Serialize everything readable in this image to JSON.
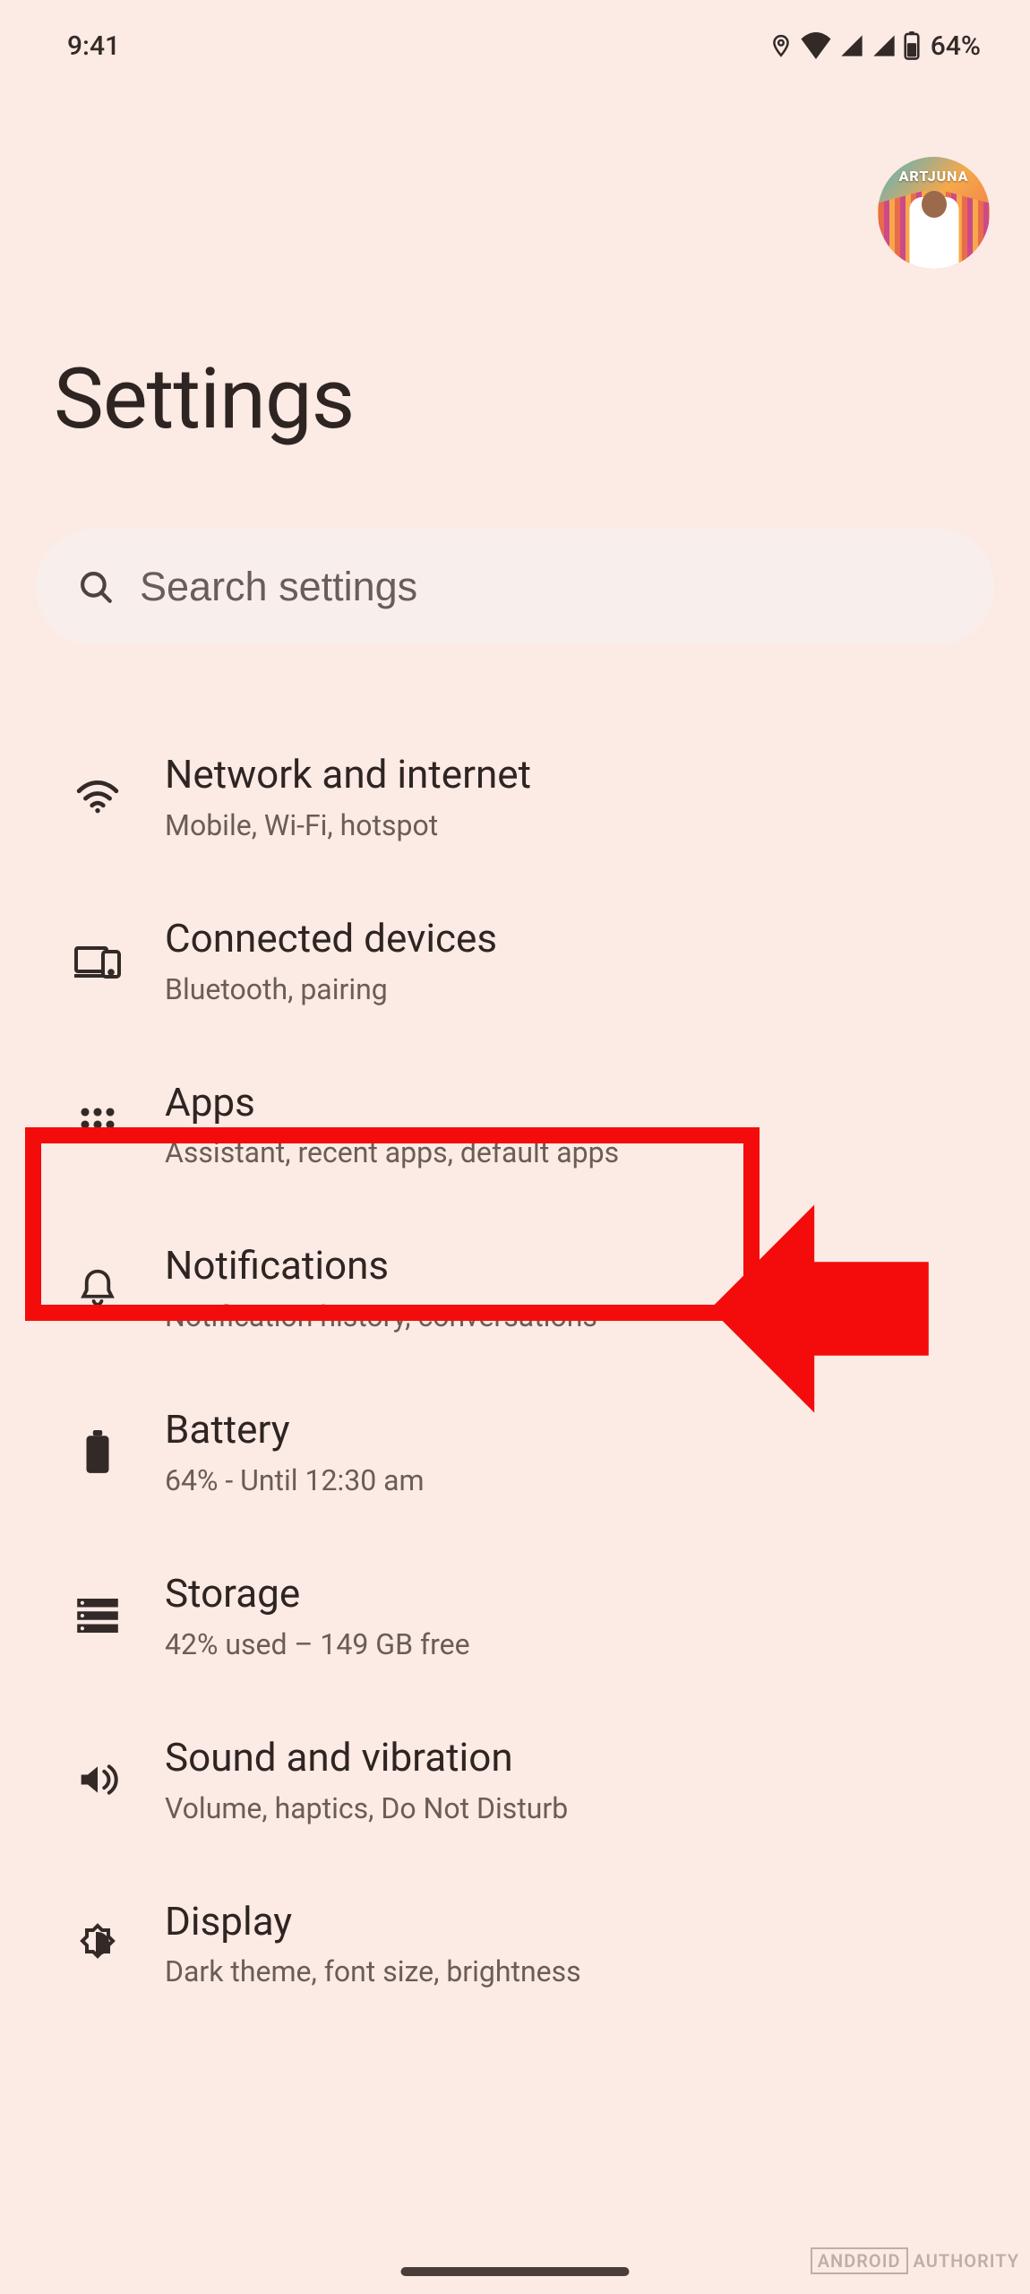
{
  "status": {
    "time": "9:41",
    "battery_text": "64%"
  },
  "header": {
    "title": "Settings",
    "avatar_label": "ARTJUNA"
  },
  "search": {
    "placeholder": "Search settings"
  },
  "items": [
    {
      "id": "network",
      "title": "Network and internet",
      "sub": "Mobile, Wi-Fi, hotspot"
    },
    {
      "id": "devices",
      "title": "Connected devices",
      "sub": "Bluetooth, pairing"
    },
    {
      "id": "apps",
      "title": "Apps",
      "sub": "Assistant, recent apps, default apps"
    },
    {
      "id": "notifications",
      "title": "Notifications",
      "sub": "Notification history, conversations"
    },
    {
      "id": "battery",
      "title": "Battery",
      "sub": "64% - Until 12:30 am"
    },
    {
      "id": "storage",
      "title": "Storage",
      "sub": "42% used – 149 GB free"
    },
    {
      "id": "sound",
      "title": "Sound and vibration",
      "sub": "Volume, haptics, Do Not Disturb"
    },
    {
      "id": "display",
      "title": "Display",
      "sub": "Dark theme, font size, brightness"
    }
  ],
  "watermark": {
    "brand": "ANDROID",
    "site": "AUTHORITY"
  },
  "annotation": {
    "highlighted_item": "apps"
  }
}
